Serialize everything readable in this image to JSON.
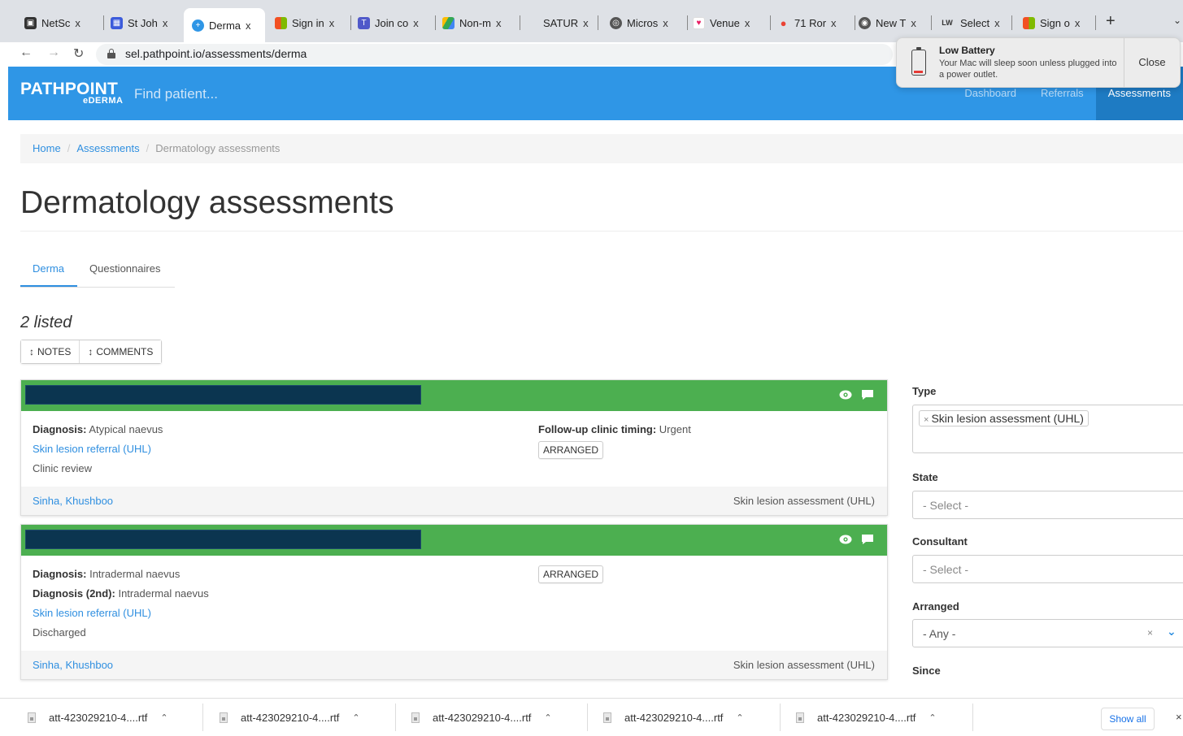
{
  "browser": {
    "tabs": [
      {
        "title": "NetSc",
        "icon": "netscaler-icon",
        "color": "#333333"
      },
      {
        "title": "St Joh",
        "icon": "stjohn-icon",
        "color": "#3b5bdb"
      },
      {
        "title": "Derma",
        "icon": "plus-circle-icon",
        "color": "#2f96e6",
        "active": true
      },
      {
        "title": "Sign in",
        "icon": "microsoft-icon",
        "color": "#f25022"
      },
      {
        "title": "Join co",
        "icon": "teams-icon",
        "color": "#5059c9"
      },
      {
        "title": "Non-m",
        "icon": "drive-icon",
        "color": "#34a853"
      },
      {
        "title": "SATUR",
        "icon": "blank-icon",
        "color": "#dee1e6"
      },
      {
        "title": "Micros",
        "icon": "globe-icon",
        "color": "#555555"
      },
      {
        "title": "Venue",
        "icon": "heart-icon",
        "color": "#e91e63"
      },
      {
        "title": "71 Ror",
        "icon": "maps-pin-icon",
        "color": "#ea4335"
      },
      {
        "title": "New T",
        "icon": "chrome-icon",
        "color": "#555555"
      },
      {
        "title": "Select",
        "icon": "lw-icon",
        "color": "#333333"
      },
      {
        "title": "Sign o",
        "icon": "microsoft-icon",
        "color": "#f25022"
      }
    ],
    "tab_close": "x",
    "new_tab": "+",
    "url": "sel.pathpoint.io/assessments/derma"
  },
  "notification": {
    "title": "Low Battery",
    "body": "Your Mac will sleep soon unless plugged into a power outlet.",
    "close_label": "Close"
  },
  "app": {
    "logo": "PATHPOINT",
    "logo_sub": "eDERMA",
    "search_placeholder": "Find patient...",
    "nav": [
      {
        "label": "Dashboard"
      },
      {
        "label": "Referrals"
      },
      {
        "label": "Assessments",
        "active": true
      }
    ]
  },
  "breadcrumb": {
    "home": "Home",
    "assessments": "Assessments",
    "current": "Dermatology assessments",
    "separator": "/"
  },
  "page_title": "Dermatology assessments",
  "subtabs": {
    "derma": "Derma",
    "questionnaires": "Questionnaires"
  },
  "listed": "2 listed",
  "buttons": {
    "notes": "NOTES",
    "comments": "COMMENTS",
    "arrows": "↕"
  },
  "cards": [
    {
      "diagnosis_label": "Diagnosis:",
      "diagnosis": "Atypical naevus",
      "referral_link": "Skin lesion referral (UHL)",
      "outcome": "Clinic review",
      "followup_label": "Follow-up clinic timing:",
      "followup": "Urgent",
      "badge": "ARRANGED",
      "author": "Sinha, Khushboo",
      "type": "Skin lesion assessment (UHL)"
    },
    {
      "diagnosis_label": "Diagnosis:",
      "diagnosis": "Intradermal naevus",
      "diagnosis2_label": "Diagnosis (2nd):",
      "diagnosis2": "Intradermal naevus",
      "referral_link": "Skin lesion referral (UHL)",
      "outcome": "Discharged",
      "badge": "ARRANGED",
      "author": "Sinha, Khushboo",
      "type": "Skin lesion assessment (UHL)"
    }
  ],
  "filters": {
    "type_label": "Type",
    "type_chip": "Skin lesion assessment (UHL)",
    "chip_remove": "×",
    "state_label": "State",
    "state_placeholder": "- Select -",
    "consultant_label": "Consultant",
    "consultant_placeholder": "- Select -",
    "arranged_label": "Arranged",
    "arranged_value": "- Any -",
    "clear": "×",
    "since_label": "Since"
  },
  "downloads": {
    "files": [
      {
        "name": "att-423029210-4....rtf"
      },
      {
        "name": "att-423029210-4....rtf"
      },
      {
        "name": "att-423029210-4....rtf"
      },
      {
        "name": "att-423029210-4....rtf"
      },
      {
        "name": "att-423029210-4....rtf"
      }
    ],
    "show_all": "Show all",
    "close": "×"
  },
  "colors": {
    "brand": "#2f96e6",
    "card_header": "#4caf50",
    "link": "#2f8fe0"
  }
}
